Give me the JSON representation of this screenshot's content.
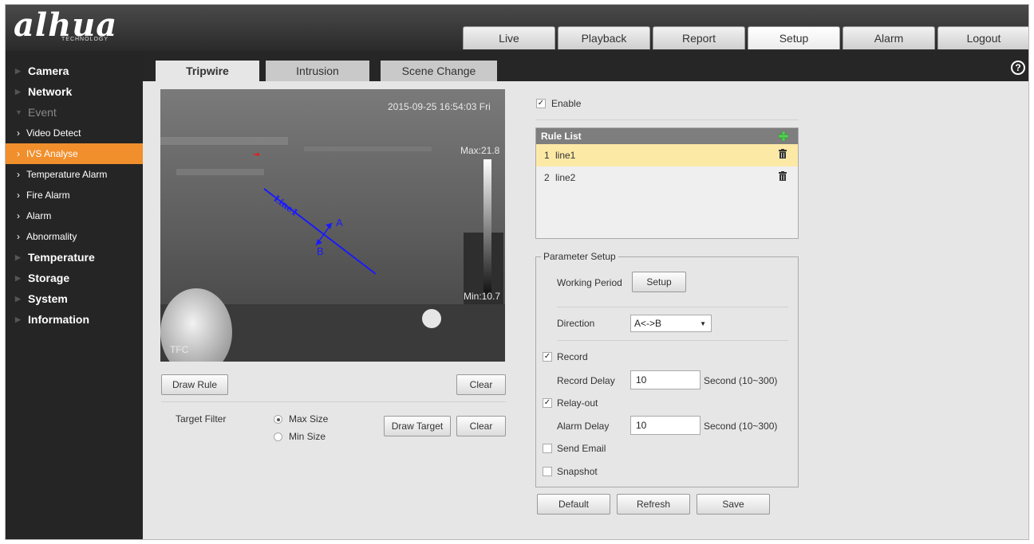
{
  "logo": {
    "text": "alhua",
    "subtext": "TECHNOLOGY"
  },
  "topnav": [
    "Live",
    "Playback",
    "Report",
    "Setup",
    "Alarm",
    "Logout"
  ],
  "topnav_active": "Setup",
  "sidebar": {
    "camera": "Camera",
    "network": "Network",
    "event": "Event",
    "video_detect": "Video Detect",
    "ivs_analyse": "IVS Analyse",
    "temperature_alarm": "Temperature Alarm",
    "fire_alarm": "Fire Alarm",
    "alarm": "Alarm",
    "abnormality": "Abnormality",
    "temperature": "Temperature",
    "storage": "Storage",
    "system": "System",
    "information": "Information"
  },
  "tabs": {
    "tripwire": "Tripwire",
    "intrusion": "Intrusion",
    "scene_change": "Scene Change"
  },
  "help_icon": "?",
  "video": {
    "timestamp": "2015-09-25 16:54:03 Fri",
    "max": "Max:21.8",
    "min": "Min:10.7",
    "osd": "TFC",
    "line_label": "Line1",
    "dir_a": "A",
    "dir_b": "B"
  },
  "draw_rule": "Draw Rule",
  "clear": "Clear",
  "target_filter": {
    "label": "Target Filter",
    "max_size": "Max Size",
    "min_size": "Min Size",
    "draw_target": "Draw Target",
    "clear": "Clear"
  },
  "enable": "Enable",
  "rule_list": {
    "header": "Rule List",
    "rules": [
      {
        "num": "1",
        "name": "line1"
      },
      {
        "num": "2",
        "name": "line2"
      }
    ]
  },
  "param": {
    "title": "Parameter Setup",
    "working_period": "Working Period",
    "setup_btn": "Setup",
    "direction": "Direction",
    "direction_value": "A<->B",
    "record": "Record",
    "record_delay": "Record Delay",
    "record_delay_value": "10",
    "record_unit": "Second (10~300)",
    "relay_out": "Relay-out",
    "alarm_delay": "Alarm Delay",
    "alarm_delay_value": "10",
    "alarm_unit": "Second (10~300)",
    "send_email": "Send Email",
    "snapshot": "Snapshot"
  },
  "footer": {
    "default": "Default",
    "refresh": "Refresh",
    "save": "Save"
  },
  "colors": {
    "accent": "#f08f2c",
    "selected_rule": "#fde9a6",
    "tripwire": "#1a1aff"
  }
}
